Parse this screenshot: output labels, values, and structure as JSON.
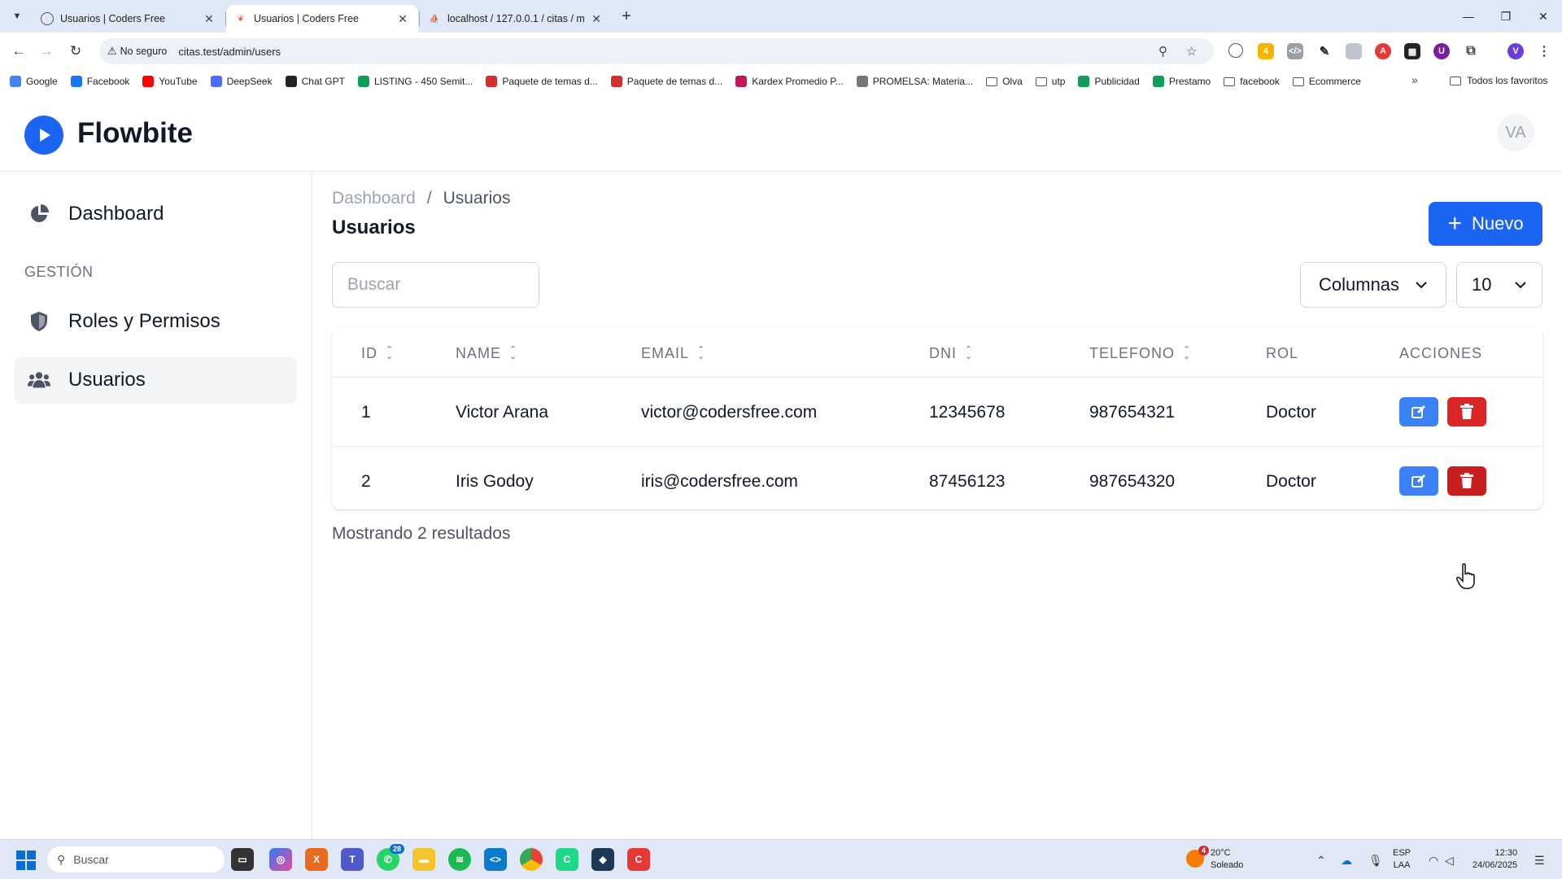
{
  "browser": {
    "tabs": [
      {
        "title": "Usuarios | Coders Free",
        "active": false
      },
      {
        "title": "Usuarios | Coders Free",
        "active": true
      },
      {
        "title": "localhost / 127.0.0.1 / citas / m",
        "active": false
      }
    ],
    "address": {
      "security_label": "No seguro",
      "url": "citas.test/admin/users"
    },
    "bookmarks": [
      {
        "label": "Google",
        "color": "#4285f4"
      },
      {
        "label": "Facebook",
        "color": "#1877f2"
      },
      {
        "label": "YouTube",
        "color": "#ff0000"
      },
      {
        "label": "DeepSeek",
        "color": "#4d6bfe"
      },
      {
        "label": "Chat GPT",
        "color": "#222222"
      },
      {
        "label": "LISTING - 450 Semit...",
        "color": "#0f9d58"
      },
      {
        "label": "Paquete de temas d...",
        "color": "#d32f2f"
      },
      {
        "label": "Paquete de temas d...",
        "color": "#d32f2f"
      },
      {
        "label": "Kardex Promedio P...",
        "color": "#c2185b"
      },
      {
        "label": "PROMELSA: Materia...",
        "color": "#777777"
      },
      {
        "label": "Olva",
        "color": "folder"
      },
      {
        "label": "utp",
        "color": "folder"
      },
      {
        "label": "Publicidad",
        "color": "#0f9d58"
      },
      {
        "label": "Prestamo",
        "color": "#0f9d58"
      },
      {
        "label": "facebook",
        "color": "folder"
      },
      {
        "label": "Ecommerce",
        "color": "folder"
      }
    ],
    "all_bookmarks_label": "Todos los favoritos"
  },
  "app": {
    "brand": "Flowbite",
    "avatar_initials": "VA",
    "accent_color": "#1c64f2",
    "sidebar": {
      "items": [
        {
          "label": "Dashboard",
          "icon": "chart-pie-icon"
        },
        {
          "label": "Roles y Permisos",
          "icon": "shield-icon"
        },
        {
          "label": "Usuarios",
          "icon": "users-icon",
          "active": true
        }
      ],
      "section_heading": "GESTIÓN"
    },
    "breadcrumb": {
      "root": "Dashboard",
      "separator": "/",
      "current": "Usuarios"
    },
    "page_title": "Usuarios",
    "new_button_label": "Nuevo",
    "search_placeholder": "Buscar",
    "columns_select_label": "Columnas",
    "per_page_value": "10",
    "table": {
      "headers": [
        "ID",
        "NAME",
        "EMAIL",
        "DNI",
        "TELEFONO",
        "ROL",
        "ACCIONES"
      ],
      "rows": [
        {
          "id": "1",
          "name": "Victor Arana",
          "email": "victor@codersfree.com",
          "dni": "12345678",
          "telefono": "987654321",
          "rol": "Doctor"
        },
        {
          "id": "2",
          "name": "Iris Godoy",
          "email": "iris@codersfree.com",
          "dni": "87456123",
          "telefono": "987654320",
          "rol": "Doctor"
        }
      ]
    },
    "results_text": "Mostrando 2 resultados"
  },
  "taskbar": {
    "search_placeholder": "Buscar",
    "whatsapp_badge": "28",
    "weather_badge": "4",
    "weather_temp": "20°C",
    "weather_desc": "Soleado",
    "lang_top": "ESP",
    "lang_bottom": "LAA",
    "time": "12:30",
    "date": "24/06/2025"
  }
}
